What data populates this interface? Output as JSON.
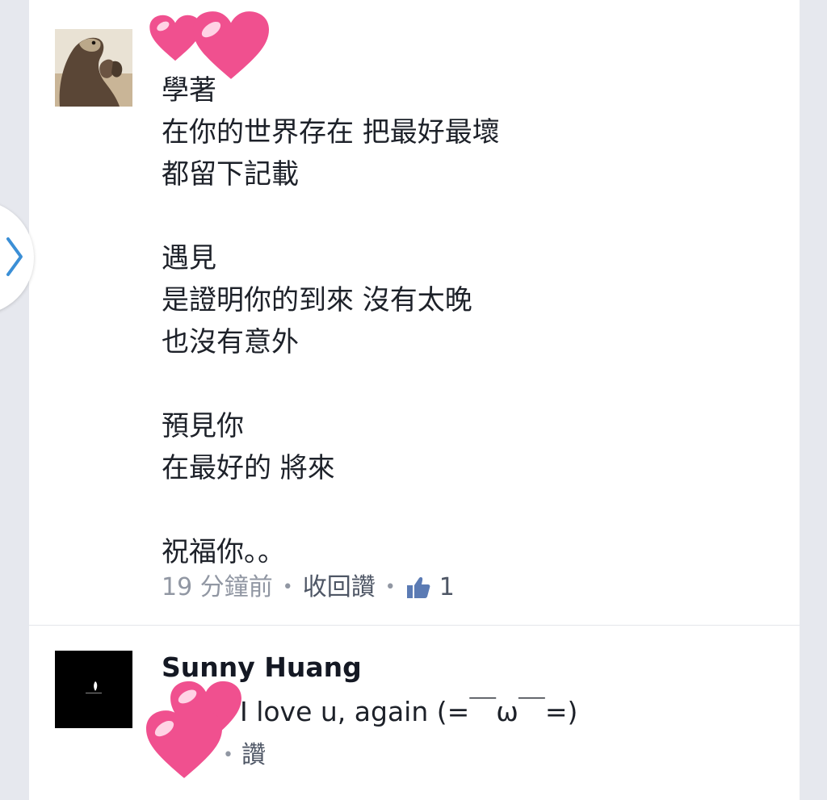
{
  "comments": [
    {
      "lines": [
        "學著",
        "在你的世界存在 把最好最壞",
        "都留下記載",
        "",
        "遇見",
        "是證明你的到來 沒有太晚",
        "也沒有意外",
        "",
        "預見你",
        "在最好的 將來",
        "",
        "祝福你。。"
      ],
      "time": "19 分鐘前",
      "unlike_label": "收回讚",
      "like_count": "1"
    },
    {
      "author": "Sunny Huang",
      "text": ". I love u,  again (=￣ω￣=)",
      "like_label": "讚"
    }
  ],
  "colors": {
    "accent": "#4e5665",
    "meta_gray": "#9197a3",
    "like_blue": "#5b7bb4",
    "heart_pink": "#f0508f",
    "nav_chevron": "#3b8fd6"
  },
  "icons": {
    "side_tab": "chevron-right-icon",
    "like": "thumbs-up-icon",
    "decoration": "heart-icon"
  }
}
